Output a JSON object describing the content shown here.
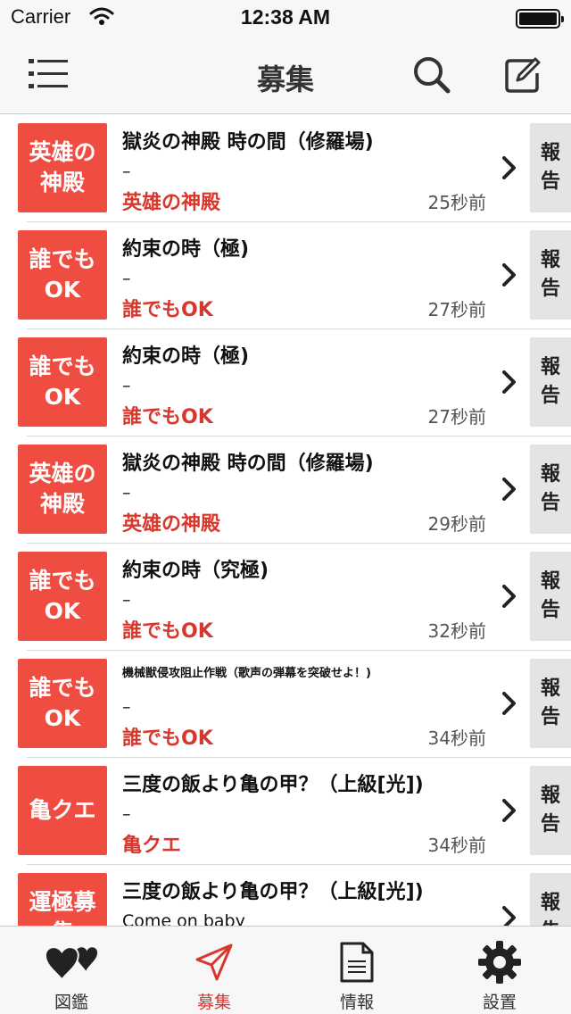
{
  "status_bar": {
    "carrier": "Carrier",
    "time": "12:38 AM"
  },
  "nav": {
    "title": "募集",
    "menu_icon": "list-icon",
    "search_icon": "search-icon",
    "compose_icon": "compose-icon"
  },
  "colors": {
    "accent": "#ef4d42",
    "category_text": "#d9362c",
    "report_bg": "#e4e4e4"
  },
  "rows": [
    {
      "badge": "英雄の\n神殿",
      "title": "獄炎の神殿 時の間（修羅場)",
      "comment": "–",
      "category": "英雄の神殿",
      "time": "25秒前",
      "report": "報\n告"
    },
    {
      "badge": "誰でも\nOK",
      "title": "約束の時（極)",
      "comment": "–",
      "category": "誰でもOK",
      "time": "27秒前",
      "report": "報\n告"
    },
    {
      "badge": "誰でも\nOK",
      "title": "約束の時（極)",
      "comment": "–",
      "category": "誰でもOK",
      "time": "27秒前",
      "report": "報\n告"
    },
    {
      "badge": "英雄の\n神殿",
      "title": "獄炎の神殿 時の間（修羅場)",
      "comment": "–",
      "category": "英雄の神殿",
      "time": "29秒前",
      "report": "報\n告"
    },
    {
      "badge": "誰でも\nOK",
      "title": "約束の時（究極)",
      "comment": "–",
      "category": "誰でもOK",
      "time": "32秒前",
      "report": "報\n告"
    },
    {
      "badge": "誰でも\nOK",
      "title": "機械獣侵攻阻止作戦（歌声の弾幕を突破せよ！)",
      "comment": "–",
      "category": "誰でもOK",
      "time": "34秒前",
      "report": "報\n告"
    },
    {
      "badge": "亀クエ",
      "title": "三度の飯より亀の甲？（上級[光])",
      "comment": "–",
      "category": "亀クエ",
      "time": "34秒前",
      "report": "報\n告"
    },
    {
      "badge": "運極募\n集",
      "title": "三度の飯より亀の甲？（上級[光])",
      "comment": "Come on baby",
      "category": "",
      "time": "",
      "report": "報\n告"
    }
  ],
  "tabs": [
    {
      "label": "図鑑",
      "icon": "hearts-icon"
    },
    {
      "label": "募集",
      "icon": "send-icon"
    },
    {
      "label": "情報",
      "icon": "document-icon"
    },
    {
      "label": "設置",
      "icon": "gear-icon"
    }
  ]
}
